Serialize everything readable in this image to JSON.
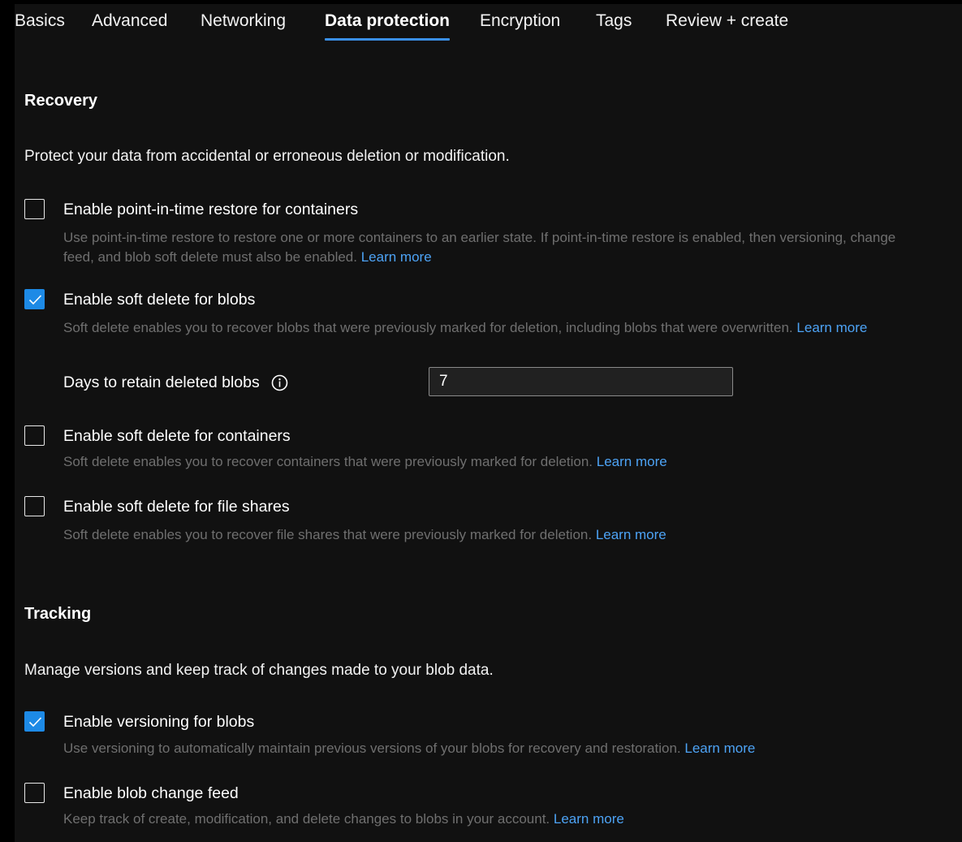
{
  "tabs": [
    {
      "label": "Basics",
      "active": false
    },
    {
      "label": "Advanced",
      "active": false
    },
    {
      "label": "Networking",
      "active": false
    },
    {
      "label": "Data protection",
      "active": true
    },
    {
      "label": "Encryption",
      "active": false
    },
    {
      "label": "Tags",
      "active": false
    },
    {
      "label": "Review + create",
      "active": false
    }
  ],
  "recovery": {
    "title": "Recovery",
    "description": "Protect your data from accidental or erroneous deletion or modification.",
    "point_in_time": {
      "label": "Enable point-in-time restore for containers",
      "checked": false,
      "help": "Use point-in-time restore to restore one or more containers to an earlier state. If point-in-time restore is enabled, then versioning, change feed, and blob soft delete must also be enabled.",
      "link": "Learn more"
    },
    "soft_delete_blobs": {
      "label": "Enable soft delete for blobs",
      "checked": true,
      "help": "Soft delete enables you to recover blobs that were previously marked for deletion, including blobs that were overwritten.",
      "link": "Learn more"
    },
    "retain_days": {
      "label": "Days to retain deleted blobs",
      "value": "7"
    },
    "soft_delete_containers": {
      "label": "Enable soft delete for containers",
      "checked": false,
      "help": "Soft delete enables you to recover containers that were previously marked for deletion.",
      "link": "Learn more"
    },
    "soft_delete_file_shares": {
      "label": "Enable soft delete for file shares",
      "checked": false,
      "help": "Soft delete enables you to recover file shares that were previously marked for deletion.",
      "link": "Learn more"
    }
  },
  "tracking": {
    "title": "Tracking",
    "description": "Manage versions and keep track of changes made to your blob data.",
    "versioning": {
      "label": "Enable versioning for blobs",
      "checked": true,
      "help": "Use versioning to automatically maintain previous versions of your blobs for recovery and restoration.",
      "link": "Learn more"
    },
    "change_feed": {
      "label": "Enable blob change feed",
      "checked": false,
      "help": "Keep track of create, modification, and delete changes to blobs in your account.",
      "link": "Learn more"
    }
  },
  "colors": {
    "accent": "#1d8ae6",
    "link": "#4da3f5",
    "background": "#111111",
    "help_text": "#6f6f6f"
  },
  "icons": {
    "info": "info-circle-icon",
    "check": "checkmark-icon"
  }
}
